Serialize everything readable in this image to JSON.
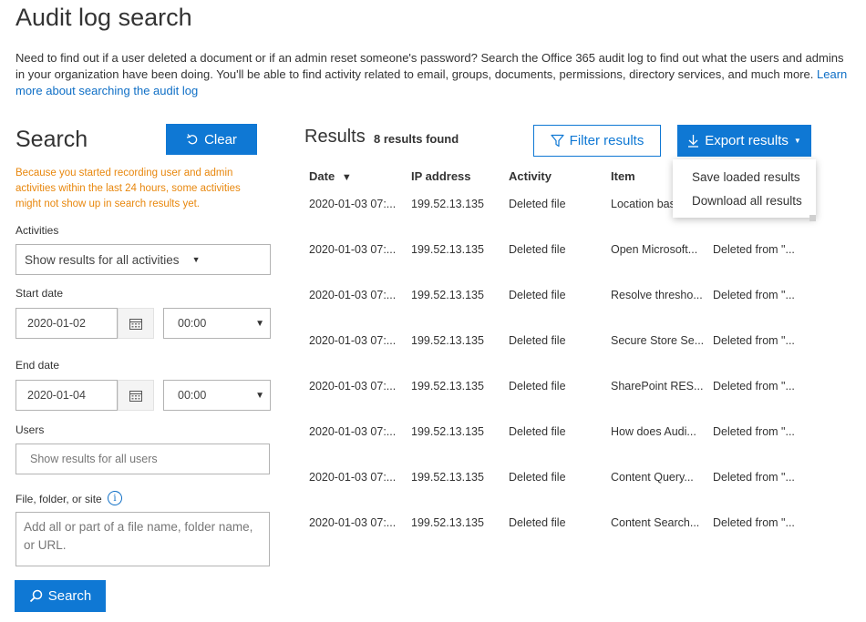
{
  "header": {
    "title": "Audit log search",
    "intro_text": "Need to find out if a user deleted a document or if an admin reset someone's password? Search the Office 365 audit log to find out what the users and admins in your organization have been doing. You'll be able to find activity related to email, groups, documents, permissions, directory services, and much more. ",
    "intro_link": "Learn more about searching the audit log"
  },
  "search": {
    "heading": "Search",
    "clear_label": "Clear",
    "warning": "Because you started recording user and admin activities within the last 24 hours, some activities might not show up in search results yet.",
    "activities_label": "Activities",
    "activities_value": "Show results for all activities",
    "start_date_label": "Start date",
    "start_date": "2020-01-02",
    "start_time": "00:00",
    "end_date_label": "End date",
    "end_date": "2020-01-04",
    "end_time": "00:00",
    "users_label": "Users",
    "users_placeholder": "Show results for all users",
    "file_label": "File, folder, or site",
    "file_placeholder": "Add all or part of a file name, folder name, or URL.",
    "search_label": "Search"
  },
  "results": {
    "heading": "Results",
    "count": "8 results found",
    "filter_label": "Filter results",
    "export_label": "Export results",
    "export_menu": [
      "Save loaded results",
      "Download all results"
    ],
    "columns": [
      "Date",
      "IP address",
      "Activity",
      "Item"
    ],
    "rows": [
      {
        "date": "2020-01-03 07:...",
        "ip": "199.52.13.135",
        "activity": "Deleted file",
        "item": "Location bas",
        "detail": ""
      },
      {
        "date": "2020-01-03 07:...",
        "ip": "199.52.13.135",
        "activity": "Deleted file",
        "item": "Open Microsoft...",
        "detail": "Deleted from \"..."
      },
      {
        "date": "2020-01-03 07:...",
        "ip": "199.52.13.135",
        "activity": "Deleted file",
        "item": "Resolve thresho...",
        "detail": "Deleted from \"..."
      },
      {
        "date": "2020-01-03 07:...",
        "ip": "199.52.13.135",
        "activity": "Deleted file",
        "item": "Secure Store Se...",
        "detail": "Deleted from \"..."
      },
      {
        "date": "2020-01-03 07:...",
        "ip": "199.52.13.135",
        "activity": "Deleted file",
        "item": "SharePoint RES...",
        "detail": "Deleted from \"..."
      },
      {
        "date": "2020-01-03 07:...",
        "ip": "199.52.13.135",
        "activity": "Deleted file",
        "item": "How does Audi...",
        "detail": "Deleted from \"..."
      },
      {
        "date": "2020-01-03 07:...",
        "ip": "199.52.13.135",
        "activity": "Deleted file",
        "item": "Content Query...",
        "detail": "Deleted from \"..."
      },
      {
        "date": "2020-01-03 07:...",
        "ip": "199.52.13.135",
        "activity": "Deleted file",
        "item": "Content Search...",
        "detail": "Deleted from \"..."
      }
    ]
  },
  "colors": {
    "accent": "#0f78d4",
    "link": "#0f6fc6",
    "warning": "#e8870d"
  }
}
